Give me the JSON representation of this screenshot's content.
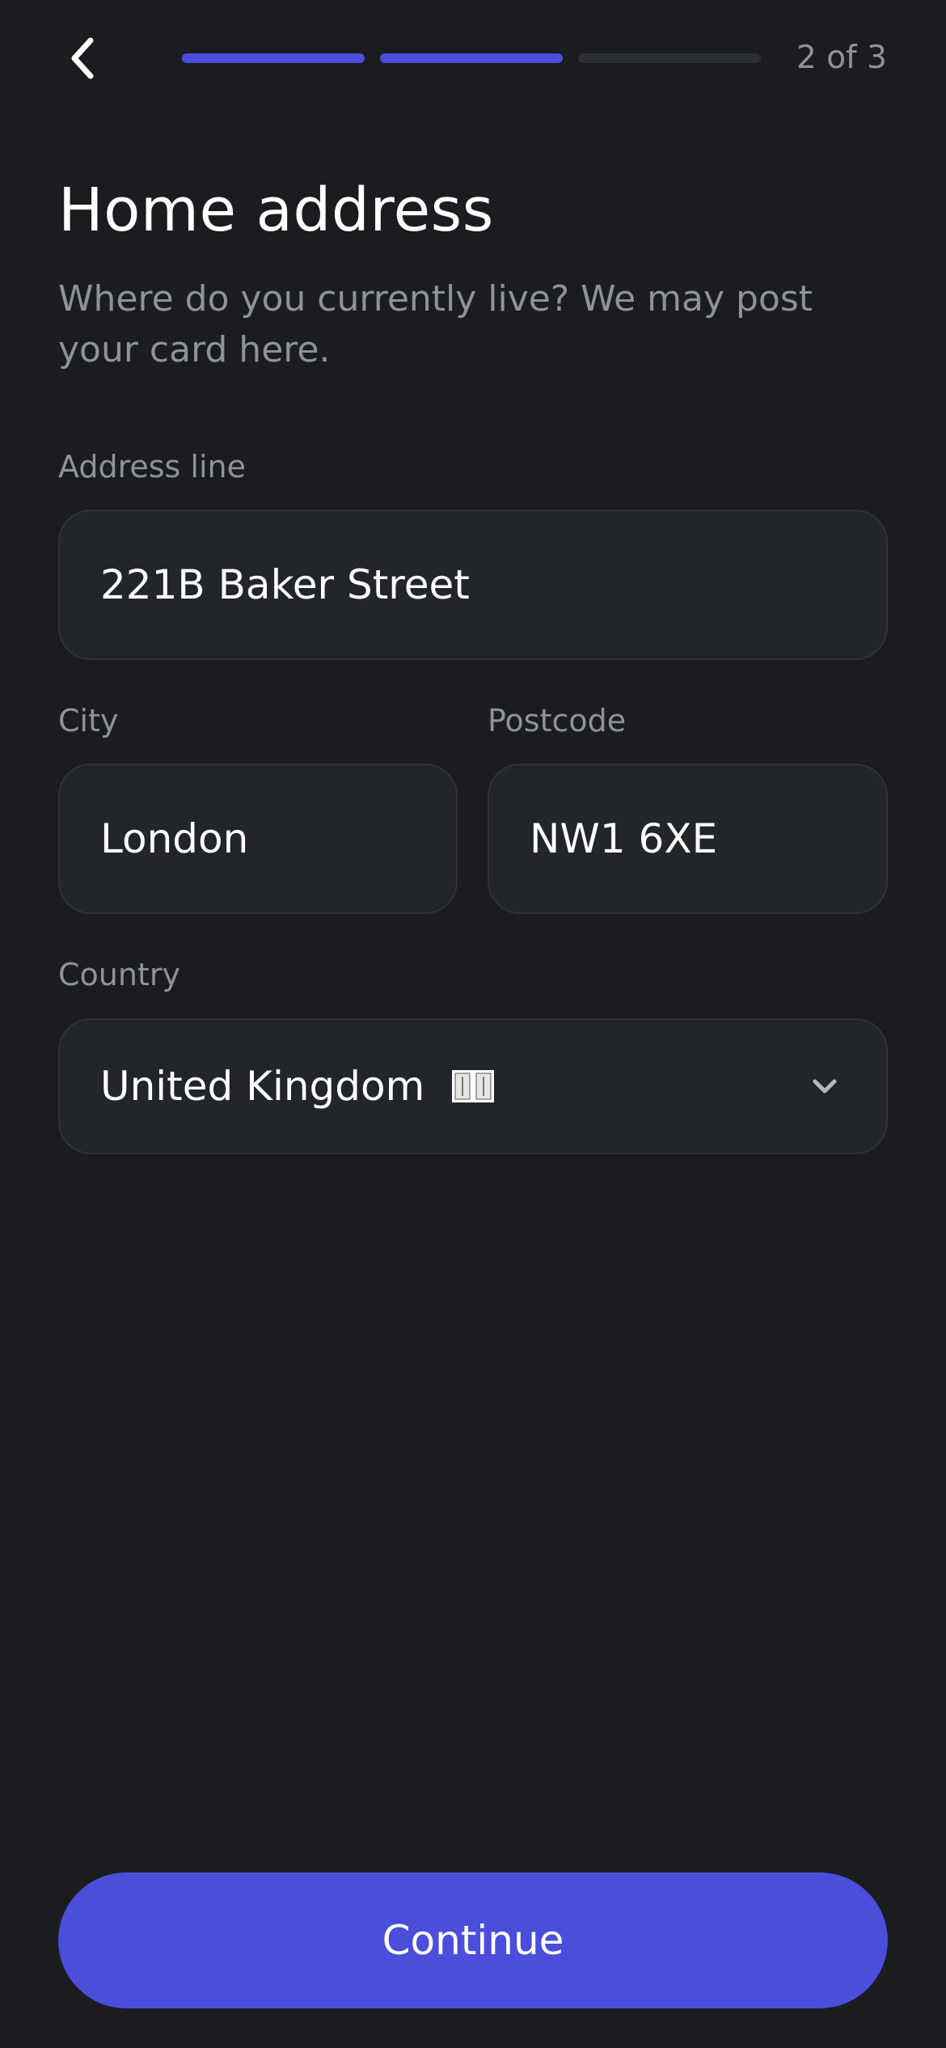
{
  "header": {
    "back_icon": "chevron-left-icon",
    "progress": {
      "completed": 2,
      "total": 3
    },
    "step_text": "2 of 3"
  },
  "page": {
    "title": "Home address",
    "subtitle": "Where do you currently live? We may post your card here."
  },
  "form": {
    "address": {
      "label": "Address line",
      "value": "221B Baker Street"
    },
    "city": {
      "label": "City",
      "value": "London"
    },
    "postcode": {
      "label": "Postcode",
      "value": "NW1 6XE"
    },
    "country": {
      "label": "Country",
      "value": "United Kingdom",
      "flag_icon": "uk-flag-icon",
      "chevron_icon": "chevron-down-icon"
    }
  },
  "actions": {
    "continue_label": "Continue"
  },
  "colors": {
    "accent": "#4b4ddb",
    "background": "#1a1c1f",
    "field_bg": "#222529",
    "muted_text": "#8e939a"
  }
}
